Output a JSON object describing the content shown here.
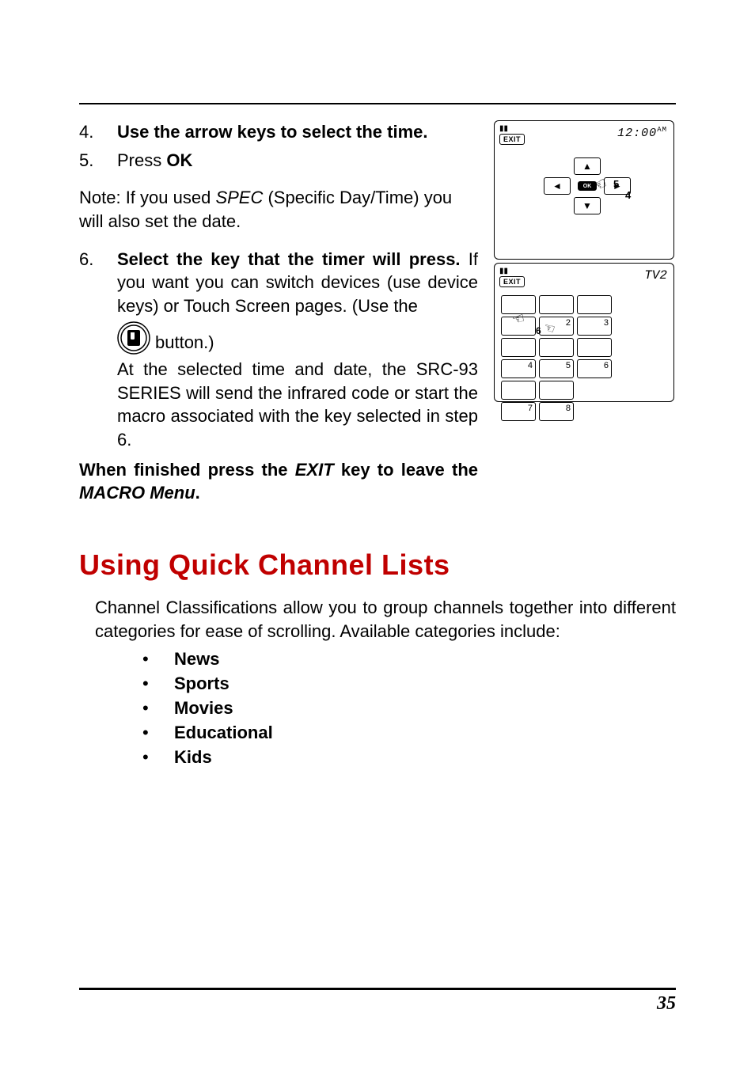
{
  "steps": {
    "s4": {
      "num": "4.",
      "text": "Use the arrow keys to select the time."
    },
    "s5": {
      "num": "5.",
      "prefix": "Press ",
      "ok": "OK"
    },
    "s6": {
      "num": "6.",
      "lead_bold": "Select the key that the timer will press.",
      "rest": " If you want you can switch devices (use device keys) or Touch Screen pages. (Use the",
      "button_word": " button.)",
      "after": "At the selected time and date, the SRC-93 SERIES will send the infrared code or start the macro associated with the key selected in step 6."
    }
  },
  "note": {
    "prefix": "Note: If you used ",
    "spec": "SPEC",
    "suffix": " (Specific Day/Time) you will also set the date."
  },
  "finish": {
    "p1": "When finished press the ",
    "exit": "EXIT",
    "p2": " key to leave the ",
    "macro": "MACRO Menu",
    "p3": "."
  },
  "section": {
    "heading": "Using Quick Channel Lists",
    "body": "Channel Classifications allow you to group channels together into different categories for ease of scrolling. Available categories include:",
    "bullets": [
      "News",
      "Sports",
      "Movies",
      "Educational",
      "Kids"
    ]
  },
  "device1": {
    "exit": "EXIT",
    "clock": "12:00",
    "ampm": "AM",
    "ok": "OK",
    "hand_5": "5",
    "hand_4": "4"
  },
  "device2": {
    "exit": "EXIT",
    "tv": "TV2",
    "keys": {
      "k2": "2",
      "k3": "3",
      "k4": "4",
      "k5": "5",
      "k6": "6",
      "k7": "7",
      "k8": "8"
    },
    "hand_6": "6"
  },
  "page_number": "35"
}
